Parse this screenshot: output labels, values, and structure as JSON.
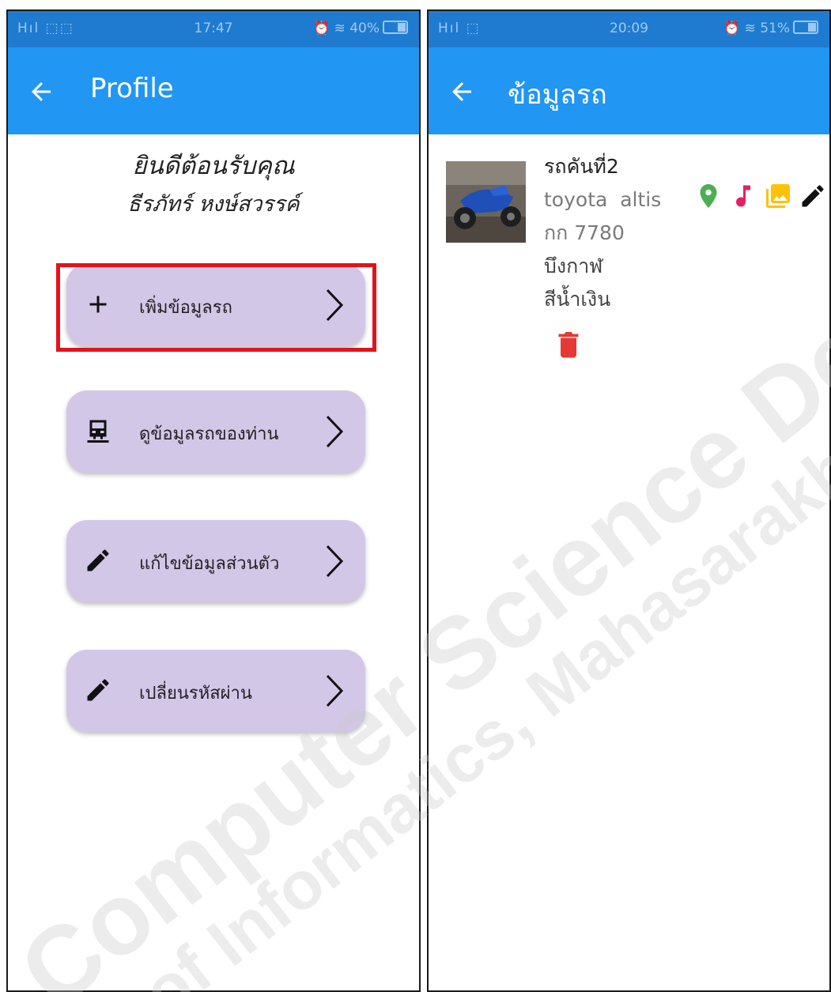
{
  "colors": {
    "appbar": "#2196f3",
    "statusbar": "#1f7bd0",
    "menu_button": "#d3c7e8",
    "highlight": "#e5121b",
    "location": "#4caf50",
    "music": "#e91e63",
    "gallery": "#ffc107",
    "delete": "#e53935"
  },
  "left_screen": {
    "status": {
      "left": "Hıl ⬚⬚",
      "time": "17:47",
      "right": "⏰ ≋ 40%"
    },
    "title": "Profile",
    "welcome_line1": "ยินดีต้อนรับคุณ",
    "welcome_line2": "ธีรภัทร์ หงษ์สวรรค์",
    "menu": [
      {
        "label": "เพิ่มข้อมูลรถ",
        "icon": "plus-icon",
        "highlighted": true
      },
      {
        "label": "ดูข้อมูลรถของท่าน",
        "icon": "car-icon"
      },
      {
        "label": "แก้ไขข้อมูลส่วนตัว",
        "icon": "pencil-icon"
      },
      {
        "label": "เปลี่ยนรหัสผ่าน",
        "icon": "pencil-icon"
      }
    ]
  },
  "right_screen": {
    "status": {
      "left": "Hıl ⬚",
      "time": "20:09",
      "right": "⏰ ≋ 51%"
    },
    "title": "ข้อมูลรถ",
    "car": {
      "name": "รถคันที่2",
      "model": "toyota  altis",
      "plate": "กก 7780",
      "province": "บึงกาฬ",
      "color": "สีน้ำเงิน"
    },
    "action_icons": [
      "location-icon",
      "music-icon",
      "gallery-icon",
      "edit-icon"
    ],
    "delete_icon": "trash-icon"
  },
  "watermark": {
    "line1": "Computer Science Department",
    "line2": "of Informatics, Mahasarakham University"
  }
}
